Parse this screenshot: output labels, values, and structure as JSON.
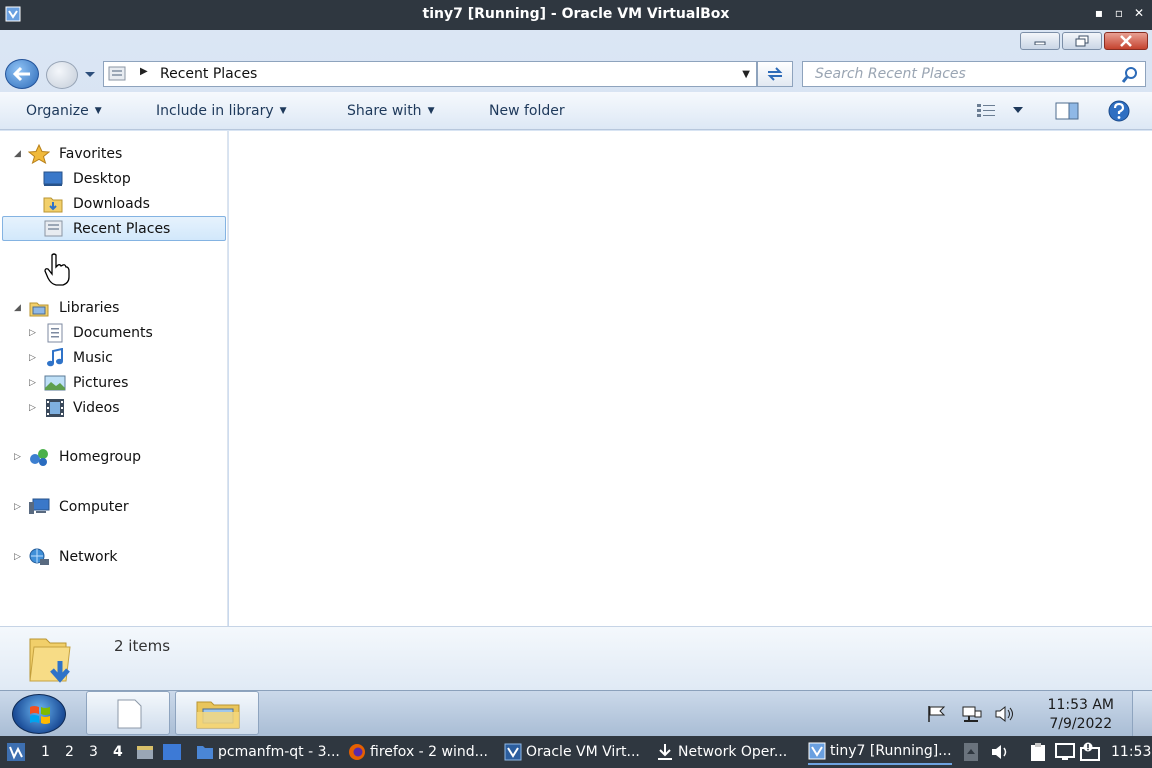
{
  "host_window": {
    "title": "tiny7 [Running] - Oracle VM VirtualBox",
    "controls": [
      "▪",
      "▫",
      "✕"
    ]
  },
  "explorer": {
    "address": {
      "path_item": "Recent Places"
    },
    "search": {
      "placeholder": "Search Recent Places"
    },
    "commands": {
      "organize": "Organize",
      "include_in_library": "Include in library",
      "share_with": "Share with",
      "new_folder": "New folder"
    },
    "nav": {
      "favorites": "Favorites",
      "desktop": "Desktop",
      "downloads": "Downloads",
      "recent_places": "Recent Places",
      "libraries": "Libraries",
      "documents": "Documents",
      "music": "Music",
      "pictures": "Pictures",
      "videos": "Videos",
      "homegroup": "Homegroup",
      "computer": "Computer",
      "network": "Network"
    },
    "details": {
      "item_count": "2 items"
    }
  },
  "guest_taskbar": {
    "clock_time": "11:53 AM",
    "clock_date": "7/9/2022"
  },
  "host_panel": {
    "workspaces": [
      "1",
      "2",
      "3",
      "4"
    ],
    "tasks": [
      {
        "label": "pcmanfm-qt - 3..."
      },
      {
        "label": "firefox - 2 wind..."
      },
      {
        "label": "Oracle VM Virt..."
      },
      {
        "label": "Network Oper..."
      },
      {
        "label": "tiny7 [Running]..."
      }
    ],
    "clock": "11:53"
  },
  "colors": {
    "host_panel": "#2f3740",
    "selection": "#d2e8fb",
    "command_text": "#1e395b"
  }
}
